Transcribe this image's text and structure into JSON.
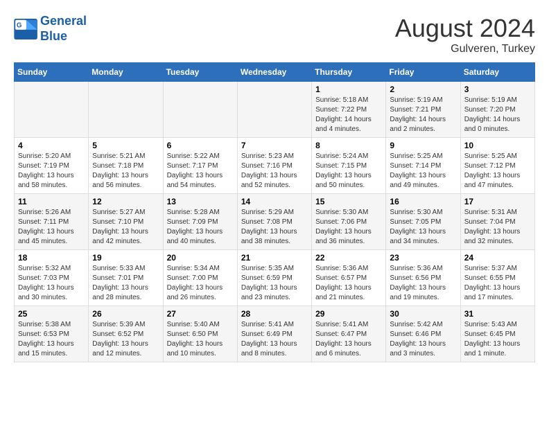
{
  "logo": {
    "line1": "General",
    "line2": "Blue"
  },
  "title": "August 2024",
  "subtitle": "Gulveren, Turkey",
  "days_of_week": [
    "Sunday",
    "Monday",
    "Tuesday",
    "Wednesday",
    "Thursday",
    "Friday",
    "Saturday"
  ],
  "weeks": [
    [
      {
        "day": "",
        "info": ""
      },
      {
        "day": "",
        "info": ""
      },
      {
        "day": "",
        "info": ""
      },
      {
        "day": "",
        "info": ""
      },
      {
        "day": "1",
        "info": "Sunrise: 5:18 AM\nSunset: 7:22 PM\nDaylight: 14 hours\nand 4 minutes."
      },
      {
        "day": "2",
        "info": "Sunrise: 5:19 AM\nSunset: 7:21 PM\nDaylight: 14 hours\nand 2 minutes."
      },
      {
        "day": "3",
        "info": "Sunrise: 5:19 AM\nSunset: 7:20 PM\nDaylight: 14 hours\nand 0 minutes."
      }
    ],
    [
      {
        "day": "4",
        "info": "Sunrise: 5:20 AM\nSunset: 7:19 PM\nDaylight: 13 hours\nand 58 minutes."
      },
      {
        "day": "5",
        "info": "Sunrise: 5:21 AM\nSunset: 7:18 PM\nDaylight: 13 hours\nand 56 minutes."
      },
      {
        "day": "6",
        "info": "Sunrise: 5:22 AM\nSunset: 7:17 PM\nDaylight: 13 hours\nand 54 minutes."
      },
      {
        "day": "7",
        "info": "Sunrise: 5:23 AM\nSunset: 7:16 PM\nDaylight: 13 hours\nand 52 minutes."
      },
      {
        "day": "8",
        "info": "Sunrise: 5:24 AM\nSunset: 7:15 PM\nDaylight: 13 hours\nand 50 minutes."
      },
      {
        "day": "9",
        "info": "Sunrise: 5:25 AM\nSunset: 7:14 PM\nDaylight: 13 hours\nand 49 minutes."
      },
      {
        "day": "10",
        "info": "Sunrise: 5:25 AM\nSunset: 7:12 PM\nDaylight: 13 hours\nand 47 minutes."
      }
    ],
    [
      {
        "day": "11",
        "info": "Sunrise: 5:26 AM\nSunset: 7:11 PM\nDaylight: 13 hours\nand 45 minutes."
      },
      {
        "day": "12",
        "info": "Sunrise: 5:27 AM\nSunset: 7:10 PM\nDaylight: 13 hours\nand 42 minutes."
      },
      {
        "day": "13",
        "info": "Sunrise: 5:28 AM\nSunset: 7:09 PM\nDaylight: 13 hours\nand 40 minutes."
      },
      {
        "day": "14",
        "info": "Sunrise: 5:29 AM\nSunset: 7:08 PM\nDaylight: 13 hours\nand 38 minutes."
      },
      {
        "day": "15",
        "info": "Sunrise: 5:30 AM\nSunset: 7:06 PM\nDaylight: 13 hours\nand 36 minutes."
      },
      {
        "day": "16",
        "info": "Sunrise: 5:30 AM\nSunset: 7:05 PM\nDaylight: 13 hours\nand 34 minutes."
      },
      {
        "day": "17",
        "info": "Sunrise: 5:31 AM\nSunset: 7:04 PM\nDaylight: 13 hours\nand 32 minutes."
      }
    ],
    [
      {
        "day": "18",
        "info": "Sunrise: 5:32 AM\nSunset: 7:03 PM\nDaylight: 13 hours\nand 30 minutes."
      },
      {
        "day": "19",
        "info": "Sunrise: 5:33 AM\nSunset: 7:01 PM\nDaylight: 13 hours\nand 28 minutes."
      },
      {
        "day": "20",
        "info": "Sunrise: 5:34 AM\nSunset: 7:00 PM\nDaylight: 13 hours\nand 26 minutes."
      },
      {
        "day": "21",
        "info": "Sunrise: 5:35 AM\nSunset: 6:59 PM\nDaylight: 13 hours\nand 23 minutes."
      },
      {
        "day": "22",
        "info": "Sunrise: 5:36 AM\nSunset: 6:57 PM\nDaylight: 13 hours\nand 21 minutes."
      },
      {
        "day": "23",
        "info": "Sunrise: 5:36 AM\nSunset: 6:56 PM\nDaylight: 13 hours\nand 19 minutes."
      },
      {
        "day": "24",
        "info": "Sunrise: 5:37 AM\nSunset: 6:55 PM\nDaylight: 13 hours\nand 17 minutes."
      }
    ],
    [
      {
        "day": "25",
        "info": "Sunrise: 5:38 AM\nSunset: 6:53 PM\nDaylight: 13 hours\nand 15 minutes."
      },
      {
        "day": "26",
        "info": "Sunrise: 5:39 AM\nSunset: 6:52 PM\nDaylight: 13 hours\nand 12 minutes."
      },
      {
        "day": "27",
        "info": "Sunrise: 5:40 AM\nSunset: 6:50 PM\nDaylight: 13 hours\nand 10 minutes."
      },
      {
        "day": "28",
        "info": "Sunrise: 5:41 AM\nSunset: 6:49 PM\nDaylight: 13 hours\nand 8 minutes."
      },
      {
        "day": "29",
        "info": "Sunrise: 5:41 AM\nSunset: 6:47 PM\nDaylight: 13 hours\nand 6 minutes."
      },
      {
        "day": "30",
        "info": "Sunrise: 5:42 AM\nSunset: 6:46 PM\nDaylight: 13 hours\nand 3 minutes."
      },
      {
        "day": "31",
        "info": "Sunrise: 5:43 AM\nSunset: 6:45 PM\nDaylight: 13 hours\nand 1 minute."
      }
    ]
  ]
}
